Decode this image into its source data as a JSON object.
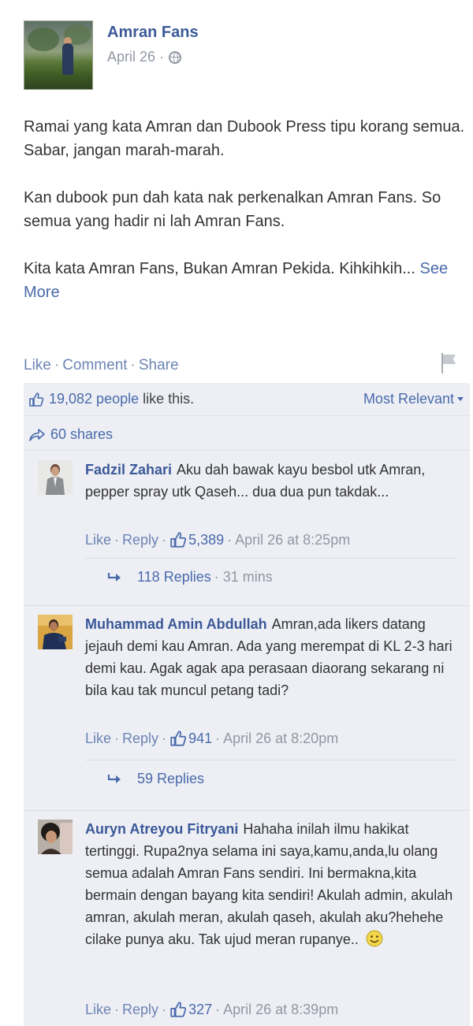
{
  "post": {
    "page_name": "Amran Fans",
    "date": "April 26 ·",
    "privacy_icon": "globe-icon",
    "paragraphs": [
      "Ramai yang kata Amran dan Dubook Press tipu korang semua. Sabar, jangan marah-marah.",
      "Kan dubook pun dah kata nak perkenalkan Amran Fans. So semua yang hadir ni lah Amran Fans.",
      "Kita kata Amran Fans, Bukan Amran Pekida. Kihkihkih..."
    ],
    "see_more": "See More"
  },
  "actions": {
    "like": "Like",
    "comment": "Comment",
    "share": "Share",
    "sep": "·"
  },
  "feedback": {
    "likes_count": "19,082 people",
    "likes_rest": "like this.",
    "sort_label": "Most Relevant",
    "shares": "60 shares"
  },
  "comments": [
    {
      "author": "Fadzil Zahari",
      "text": "Aku dah bawak kayu besbol utk Amran, pepper spray utk Qaseh... dua dua pun takdak...",
      "like": "Like",
      "reply": "Reply",
      "likes": "5,389",
      "time": "April 26 at 8:25pm",
      "replies": "118 Replies",
      "replies_time": "· 31 mins"
    },
    {
      "author": "Muhammad Amin Abdullah",
      "text": "Amran,ada likers datang jejauh demi kau Amran. Ada yang merempat di KL 2-3 hari demi kau. Agak agak apa perasaan diaorang sekarang ni bila kau tak muncul petang tadi?",
      "like": "Like",
      "reply": "Reply",
      "likes": "941",
      "time": "April 26 at 8:20pm",
      "replies": "59 Replies",
      "replies_time": ""
    },
    {
      "author": "Auryn Atreyou Fitryani",
      "text": "Hahaha inilah ilmu hakikat tertinggi. Rupa2nya selama ini saya,kamu,anda,lu olang semua adalah Amran Fans sendiri. Ini bermakna,kita bermain dengan bayang kita sendiri! Akulah admin, akulah amran, akulah meran, akulah qaseh, akulah aku?hehehe cilake punya aku. Tak ujud meran rupanye..",
      "like": "Like",
      "reply": "Reply",
      "likes": "327",
      "time": "April 26 at 8:39pm"
    }
  ],
  "colors": {
    "brand": "#3b5998",
    "link": "#4a6aab",
    "feedback_bg": "#edeff5"
  }
}
